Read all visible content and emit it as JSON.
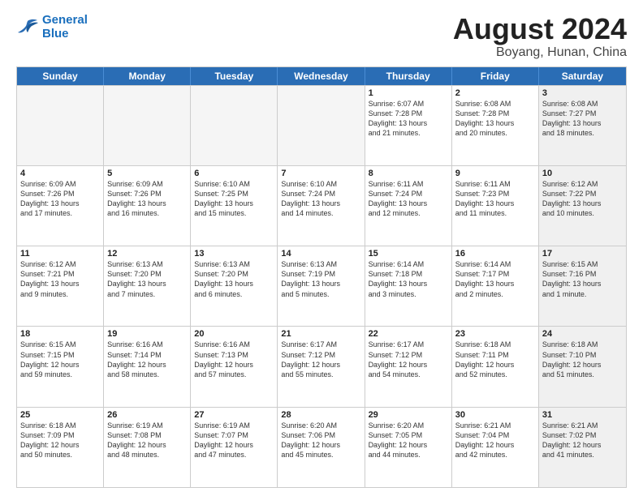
{
  "logo": {
    "line1": "General",
    "line2": "Blue"
  },
  "title": "August 2024",
  "subtitle": "Boyang, Hunan, China",
  "header": {
    "days": [
      "Sunday",
      "Monday",
      "Tuesday",
      "Wednesday",
      "Thursday",
      "Friday",
      "Saturday"
    ]
  },
  "rows": [
    [
      {
        "day": "",
        "empty": true
      },
      {
        "day": "",
        "empty": true
      },
      {
        "day": "",
        "empty": true
      },
      {
        "day": "",
        "empty": true
      },
      {
        "day": "1",
        "line1": "Sunrise: 6:07 AM",
        "line2": "Sunset: 7:28 PM",
        "line3": "Daylight: 13 hours",
        "line4": "and 21 minutes."
      },
      {
        "day": "2",
        "line1": "Sunrise: 6:08 AM",
        "line2": "Sunset: 7:28 PM",
        "line3": "Daylight: 13 hours",
        "line4": "and 20 minutes."
      },
      {
        "day": "3",
        "line1": "Sunrise: 6:08 AM",
        "line2": "Sunset: 7:27 PM",
        "line3": "Daylight: 13 hours",
        "line4": "and 18 minutes.",
        "shaded": true
      }
    ],
    [
      {
        "day": "4",
        "line1": "Sunrise: 6:09 AM",
        "line2": "Sunset: 7:26 PM",
        "line3": "Daylight: 13 hours",
        "line4": "and 17 minutes."
      },
      {
        "day": "5",
        "line1": "Sunrise: 6:09 AM",
        "line2": "Sunset: 7:26 PM",
        "line3": "Daylight: 13 hours",
        "line4": "and 16 minutes."
      },
      {
        "day": "6",
        "line1": "Sunrise: 6:10 AM",
        "line2": "Sunset: 7:25 PM",
        "line3": "Daylight: 13 hours",
        "line4": "and 15 minutes."
      },
      {
        "day": "7",
        "line1": "Sunrise: 6:10 AM",
        "line2": "Sunset: 7:24 PM",
        "line3": "Daylight: 13 hours",
        "line4": "and 14 minutes."
      },
      {
        "day": "8",
        "line1": "Sunrise: 6:11 AM",
        "line2": "Sunset: 7:24 PM",
        "line3": "Daylight: 13 hours",
        "line4": "and 12 minutes."
      },
      {
        "day": "9",
        "line1": "Sunrise: 6:11 AM",
        "line2": "Sunset: 7:23 PM",
        "line3": "Daylight: 13 hours",
        "line4": "and 11 minutes."
      },
      {
        "day": "10",
        "line1": "Sunrise: 6:12 AM",
        "line2": "Sunset: 7:22 PM",
        "line3": "Daylight: 13 hours",
        "line4": "and 10 minutes.",
        "shaded": true
      }
    ],
    [
      {
        "day": "11",
        "line1": "Sunrise: 6:12 AM",
        "line2": "Sunset: 7:21 PM",
        "line3": "Daylight: 13 hours",
        "line4": "and 9 minutes."
      },
      {
        "day": "12",
        "line1": "Sunrise: 6:13 AM",
        "line2": "Sunset: 7:20 PM",
        "line3": "Daylight: 13 hours",
        "line4": "and 7 minutes."
      },
      {
        "day": "13",
        "line1": "Sunrise: 6:13 AM",
        "line2": "Sunset: 7:20 PM",
        "line3": "Daylight: 13 hours",
        "line4": "and 6 minutes."
      },
      {
        "day": "14",
        "line1": "Sunrise: 6:13 AM",
        "line2": "Sunset: 7:19 PM",
        "line3": "Daylight: 13 hours",
        "line4": "and 5 minutes."
      },
      {
        "day": "15",
        "line1": "Sunrise: 6:14 AM",
        "line2": "Sunset: 7:18 PM",
        "line3": "Daylight: 13 hours",
        "line4": "and 3 minutes."
      },
      {
        "day": "16",
        "line1": "Sunrise: 6:14 AM",
        "line2": "Sunset: 7:17 PM",
        "line3": "Daylight: 13 hours",
        "line4": "and 2 minutes."
      },
      {
        "day": "17",
        "line1": "Sunrise: 6:15 AM",
        "line2": "Sunset: 7:16 PM",
        "line3": "Daylight: 13 hours",
        "line4": "and 1 minute.",
        "shaded": true
      }
    ],
    [
      {
        "day": "18",
        "line1": "Sunrise: 6:15 AM",
        "line2": "Sunset: 7:15 PM",
        "line3": "Daylight: 12 hours",
        "line4": "and 59 minutes."
      },
      {
        "day": "19",
        "line1": "Sunrise: 6:16 AM",
        "line2": "Sunset: 7:14 PM",
        "line3": "Daylight: 12 hours",
        "line4": "and 58 minutes."
      },
      {
        "day": "20",
        "line1": "Sunrise: 6:16 AM",
        "line2": "Sunset: 7:13 PM",
        "line3": "Daylight: 12 hours",
        "line4": "and 57 minutes."
      },
      {
        "day": "21",
        "line1": "Sunrise: 6:17 AM",
        "line2": "Sunset: 7:12 PM",
        "line3": "Daylight: 12 hours",
        "line4": "and 55 minutes."
      },
      {
        "day": "22",
        "line1": "Sunrise: 6:17 AM",
        "line2": "Sunset: 7:12 PM",
        "line3": "Daylight: 12 hours",
        "line4": "and 54 minutes."
      },
      {
        "day": "23",
        "line1": "Sunrise: 6:18 AM",
        "line2": "Sunset: 7:11 PM",
        "line3": "Daylight: 12 hours",
        "line4": "and 52 minutes."
      },
      {
        "day": "24",
        "line1": "Sunrise: 6:18 AM",
        "line2": "Sunset: 7:10 PM",
        "line3": "Daylight: 12 hours",
        "line4": "and 51 minutes.",
        "shaded": true
      }
    ],
    [
      {
        "day": "25",
        "line1": "Sunrise: 6:18 AM",
        "line2": "Sunset: 7:09 PM",
        "line3": "Daylight: 12 hours",
        "line4": "and 50 minutes."
      },
      {
        "day": "26",
        "line1": "Sunrise: 6:19 AM",
        "line2": "Sunset: 7:08 PM",
        "line3": "Daylight: 12 hours",
        "line4": "and 48 minutes."
      },
      {
        "day": "27",
        "line1": "Sunrise: 6:19 AM",
        "line2": "Sunset: 7:07 PM",
        "line3": "Daylight: 12 hours",
        "line4": "and 47 minutes."
      },
      {
        "day": "28",
        "line1": "Sunrise: 6:20 AM",
        "line2": "Sunset: 7:06 PM",
        "line3": "Daylight: 12 hours",
        "line4": "and 45 minutes."
      },
      {
        "day": "29",
        "line1": "Sunrise: 6:20 AM",
        "line2": "Sunset: 7:05 PM",
        "line3": "Daylight: 12 hours",
        "line4": "and 44 minutes."
      },
      {
        "day": "30",
        "line1": "Sunrise: 6:21 AM",
        "line2": "Sunset: 7:04 PM",
        "line3": "Daylight: 12 hours",
        "line4": "and 42 minutes."
      },
      {
        "day": "31",
        "line1": "Sunrise: 6:21 AM",
        "line2": "Sunset: 7:02 PM",
        "line3": "Daylight: 12 hours",
        "line4": "and 41 minutes.",
        "shaded": true
      }
    ]
  ]
}
